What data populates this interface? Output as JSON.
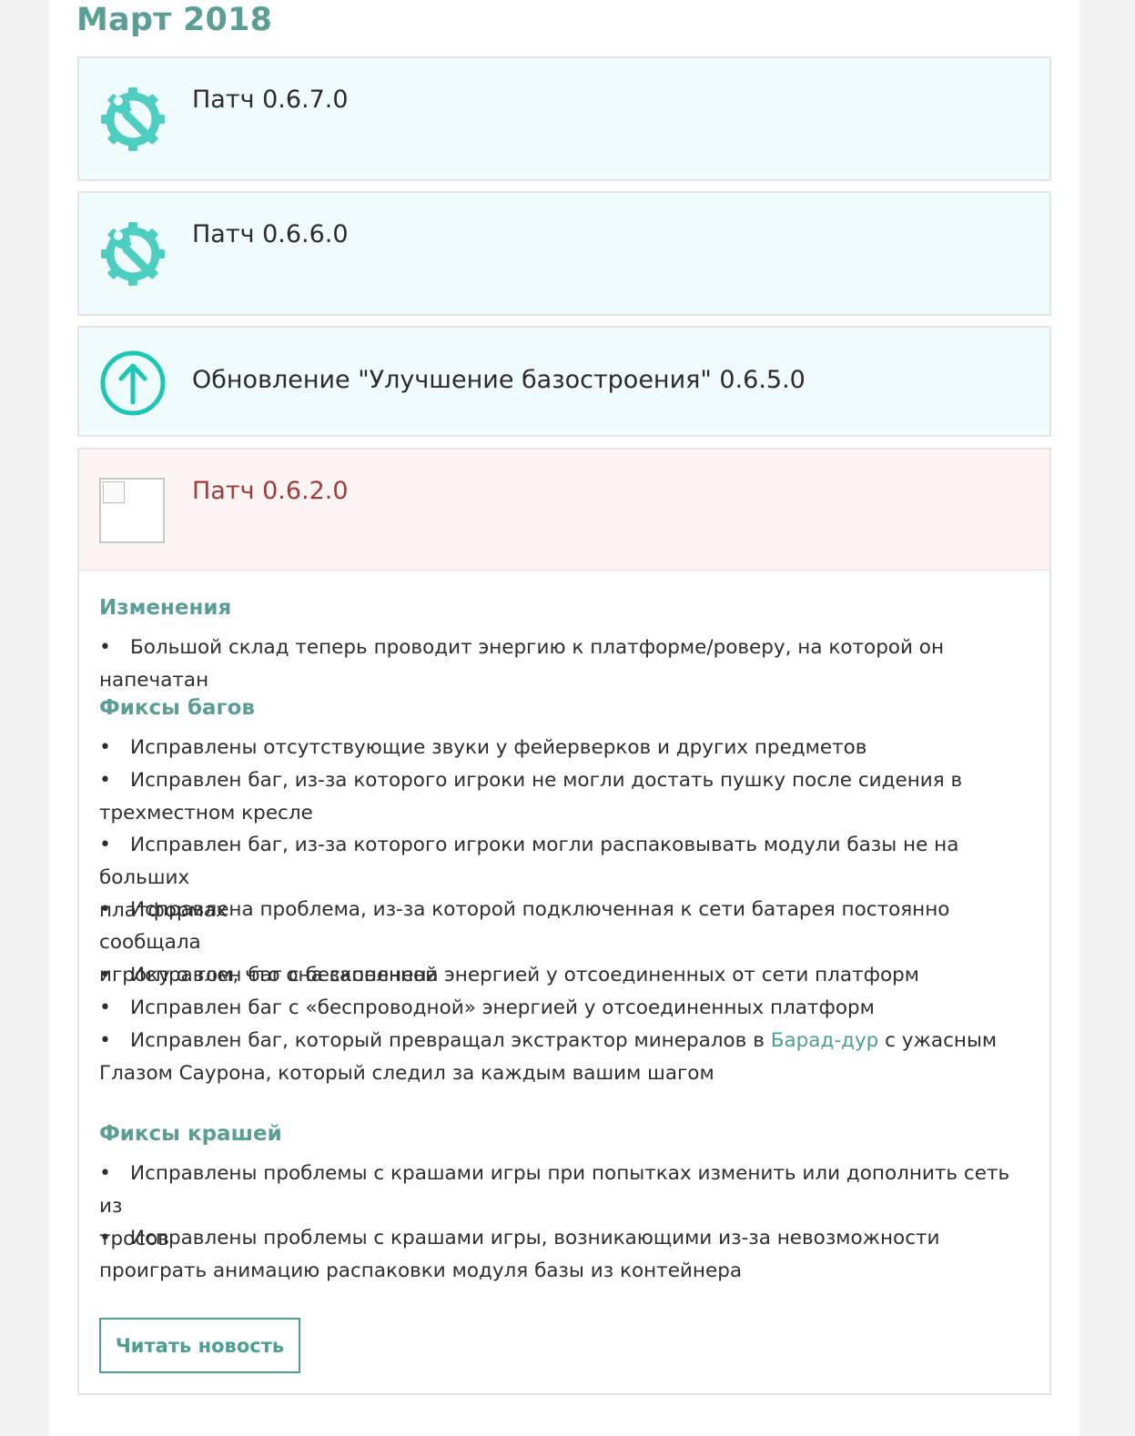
{
  "month_title": "Март 2018",
  "colors": {
    "accent": "#5b9e95",
    "patch_bg": "#effcfb",
    "expanded_bg": "#fdf5f4",
    "expanded_title": "#a33a3a"
  },
  "entries": [
    {
      "icon": "gear-wrench-icon",
      "title": "Патч 0.6.7.0"
    },
    {
      "icon": "gear-wrench-icon",
      "title": "Патч 0.6.6.0"
    },
    {
      "icon": "arrow-up-circle-icon",
      "title": "Обновление \"Улучшение базостроения\" 0.6.5.0"
    },
    {
      "icon": "broken-image-icon",
      "title": "Патч 0.6.2.0"
    }
  ],
  "details": {
    "changes_heading": "Изменения",
    "changes": [
      "Большой склад теперь проводит энергию к платформе/роверу, на которой он напечатан"
    ],
    "bugfix_heading": "Фиксы багов",
    "bugfixes": [
      {
        "line1": "Исправлены отсутствующие звуки у фейерверков и других предметов",
        "line2": ""
      },
      {
        "line1": "Исправлен баг, из-за которого игроки не могли достать пушку после сидения в",
        "line2": "трехместном кресле"
      },
      {
        "line1": "Исправлен баг, из-за которого игроки могли распаковывать модули базы не на больших",
        "line2": "платформах"
      },
      {
        "line1": "Исправлена проблема, из-за которой подключенная к сети батарея постоянно сообщала",
        "line2": "игроку о том, что она заполнена"
      },
      {
        "line1": "Исправлен баг с бесконечной энергией у отсоединенных от сети платформ",
        "line2": ""
      },
      {
        "line1": "Исправлен баг с «беспроводной» энергией у отсоединенных платформ",
        "line2": ""
      }
    ],
    "last_bugfix": {
      "before": "Исправлен баг, который превращал экстрактор минералов в ",
      "link": "Барад-дур",
      "after": " с ужасным",
      "line2": "Глазом Саурона, который следил за каждым вашим шагом"
    },
    "crash_heading": "Фиксы крашей",
    "crashfixes": [
      {
        "line1": "Исправлены проблемы с крашами игры при попытках изменить или дополнить сеть из",
        "line2": "тросов"
      },
      {
        "line1": "Исправлены проблемы с крашами игры, возникающими из-за невозможности",
        "line2": "проиграть анимацию распаковки модуля базы из контейнера"
      }
    ],
    "read_button": "Читать новость"
  }
}
